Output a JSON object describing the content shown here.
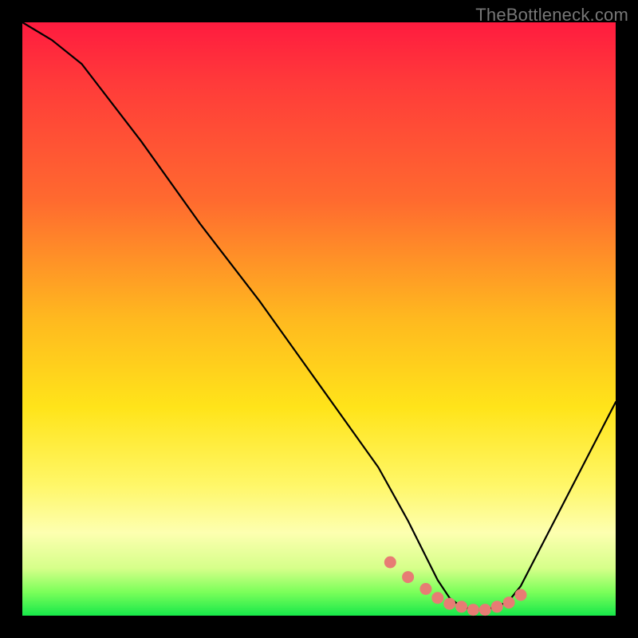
{
  "watermark": "TheBottleneck.com",
  "chart_data": {
    "type": "line",
    "title": "",
    "xlabel": "",
    "ylabel": "",
    "xlim": [
      0,
      100
    ],
    "ylim": [
      0,
      100
    ],
    "series": [
      {
        "name": "bottleneck-curve",
        "x": [
          0,
          5,
          10,
          20,
          30,
          40,
          50,
          60,
          65,
          68,
          70,
          72,
          74,
          76,
          78,
          80,
          82,
          84,
          100
        ],
        "values": [
          100,
          97,
          93,
          80,
          66,
          53,
          39,
          25,
          16,
          10,
          6,
          3,
          1.5,
          1,
          1,
          1.5,
          2.5,
          5,
          36
        ]
      }
    ],
    "markers": {
      "name": "highlight-dots",
      "color": "#e77c74",
      "x": [
        62,
        65,
        68,
        70,
        72,
        74,
        76,
        78,
        80,
        82,
        84
      ],
      "values": [
        9,
        6.5,
        4.5,
        3,
        2,
        1.5,
        1,
        1,
        1.5,
        2.2,
        3.5
      ]
    },
    "gradient_note": "Background encodes severity: red (high) at top to green (low) at bottom."
  }
}
